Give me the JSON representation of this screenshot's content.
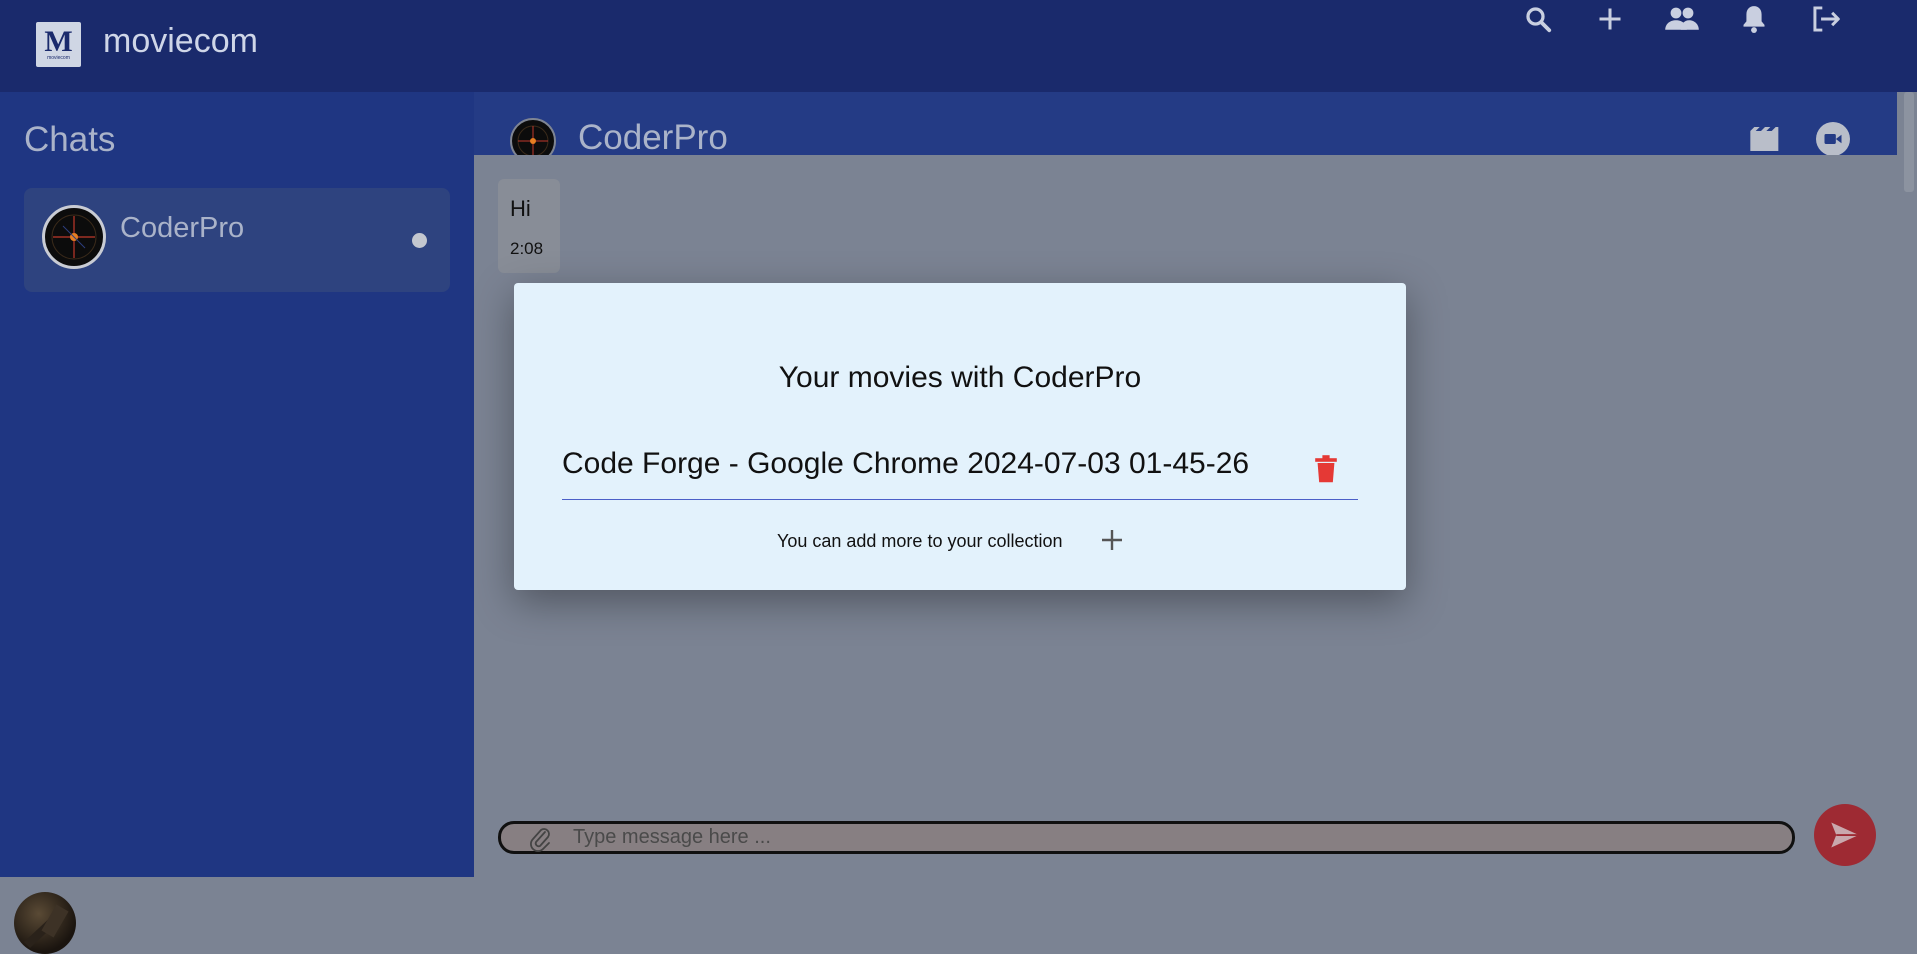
{
  "app": {
    "logo_text": "M",
    "logo_subtext": "moviecom",
    "brand": "moviecom"
  },
  "topbar_icons": [
    "search-icon",
    "add-icon",
    "people-icon",
    "bell-icon",
    "logout-icon"
  ],
  "sidebar": {
    "title": "Chats",
    "chats": [
      {
        "name": "CoderPro",
        "online": true
      }
    ]
  },
  "chat": {
    "name": "CoderPro",
    "header_icons": [
      "movie-icon",
      "video-call-icon"
    ],
    "messages": [
      {
        "text": "Hi",
        "time": "2:08"
      }
    ],
    "composer": {
      "placeholder": "Type message here ..."
    }
  },
  "modal": {
    "title": "Your movies with CoderPro",
    "movies": [
      {
        "title": "Code Forge - Google Chrome 2024-07-03 01-45-26"
      }
    ],
    "add_more_text": "You can add more to your collection"
  },
  "colors": {
    "topbar": "#1a2a6c",
    "sidebar": "#1f3682",
    "overlay": "#7b8393",
    "modal_bg": "#e3f2fc",
    "delete": "#e53935",
    "send": "#9e2a33"
  }
}
